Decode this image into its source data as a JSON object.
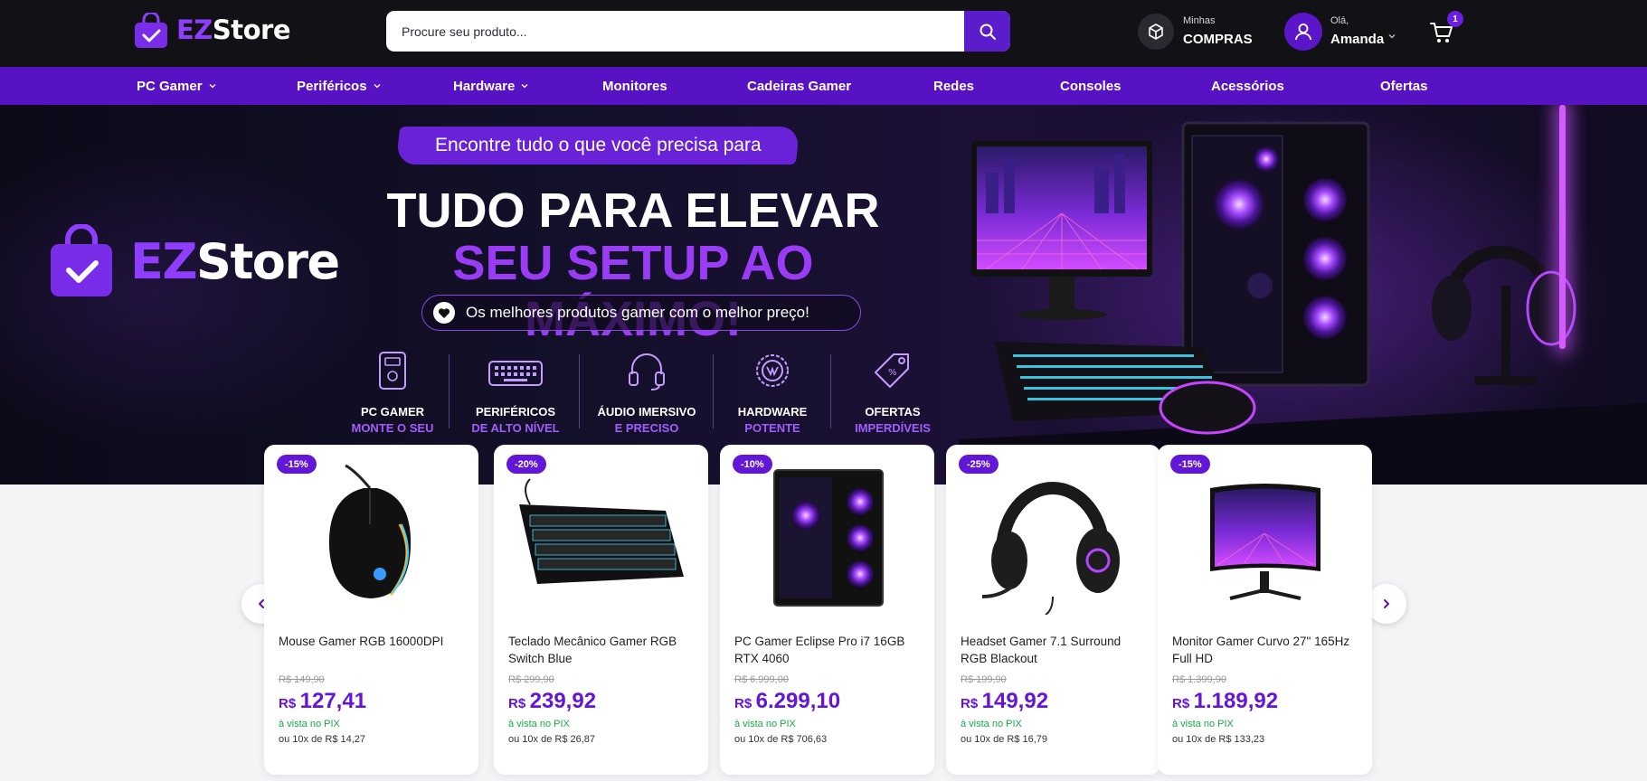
{
  "header": {
    "logo": {
      "ez": "EZ",
      "store": "Store"
    },
    "search": {
      "placeholder": "Procure seu produto..."
    },
    "orders": {
      "line1": "Minhas",
      "line2": "COMPRAS"
    },
    "account": {
      "greeting": "Olá,",
      "name": "Amanda"
    },
    "cart": {
      "count": "1"
    }
  },
  "nav": {
    "items": [
      {
        "label": "PC Gamer",
        "dropdown": true
      },
      {
        "label": "Periféricos",
        "dropdown": true
      },
      {
        "label": "Hardware",
        "dropdown": true
      },
      {
        "label": "Monitores",
        "dropdown": false
      },
      {
        "label": "Cadeiras Gamer",
        "dropdown": false
      },
      {
        "label": "Redes",
        "dropdown": false
      },
      {
        "label": "Consoles",
        "dropdown": false
      },
      {
        "label": "Acessórios",
        "dropdown": false
      },
      {
        "label": "Ofertas",
        "dropdown": false
      }
    ]
  },
  "hero": {
    "logo": {
      "ez": "EZ",
      "store": "Store"
    },
    "tagline": "Encontre tudo o que você precisa para",
    "headline1": "TUDO PARA ELEVAR",
    "headline2": "SEU SETUP AO MÁXIMO!",
    "pill": "Os melhores produtos gamer com o melhor preço!",
    "features": [
      {
        "icon": "pc-tower-icon",
        "line1": "PC GAMER",
        "line2": "MONTE O SEU"
      },
      {
        "icon": "keyboard-icon",
        "line1": "PERIFÉRICOS",
        "line2": "DE ALTO NÍVEL"
      },
      {
        "icon": "headset-icon",
        "line1": "ÁUDIO IMERSIVO",
        "line2": "E PRECISO"
      },
      {
        "icon": "chip-badge-icon",
        "line1": "HARDWARE",
        "line2": "POTENTE"
      },
      {
        "icon": "price-tag-icon",
        "line1": "OFERTAS",
        "line2": "IMPERDÍVEIS"
      }
    ]
  },
  "products": [
    {
      "discount": "-15%",
      "name": "Mouse Gamer RGB 16000DPI",
      "old": "R$ 149,90",
      "currency": "R$",
      "price": "127,41",
      "pix": "à vista no PIX",
      "installments": "ou 10x de R$ 14,27",
      "image": "mouse"
    },
    {
      "discount": "-20%",
      "name": "Teclado Mecânico Gamer RGB Switch Blue",
      "old": "R$ 299,90",
      "currency": "R$",
      "price": "239,92",
      "pix": "à vista no PIX",
      "installments": "ou 10x de R$ 26,87",
      "image": "keyboard"
    },
    {
      "discount": "-10%",
      "name": "PC Gamer Eclipse Pro i7 16GB RTX 4060",
      "old": "R$ 6.999,00",
      "currency": "R$",
      "price": "6.299,10",
      "pix": "à vista no PIX",
      "installments": "ou 10x de R$ 706,63",
      "image": "pc"
    },
    {
      "discount": "-25%",
      "name": "Headset Gamer 7.1 Surround RGB Blackout",
      "old": "R$ 199,90",
      "currency": "R$",
      "price": "149,92",
      "pix": "à vista no PIX",
      "installments": "ou 10x de R$ 16,79",
      "image": "headset"
    },
    {
      "discount": "-15%",
      "name": "Monitor Gamer Curvo 27\" 165Hz Full HD",
      "old": "R$ 1.399,90",
      "currency": "R$",
      "price": "1.189,92",
      "pix": "à vista no PIX",
      "installments": "ou 10x de R$ 133,23",
      "image": "monitor"
    }
  ],
  "colors": {
    "brand": "#5712c4",
    "accent": "#8f3dff",
    "price": "#6515d9",
    "pix": "#1aa84a"
  }
}
